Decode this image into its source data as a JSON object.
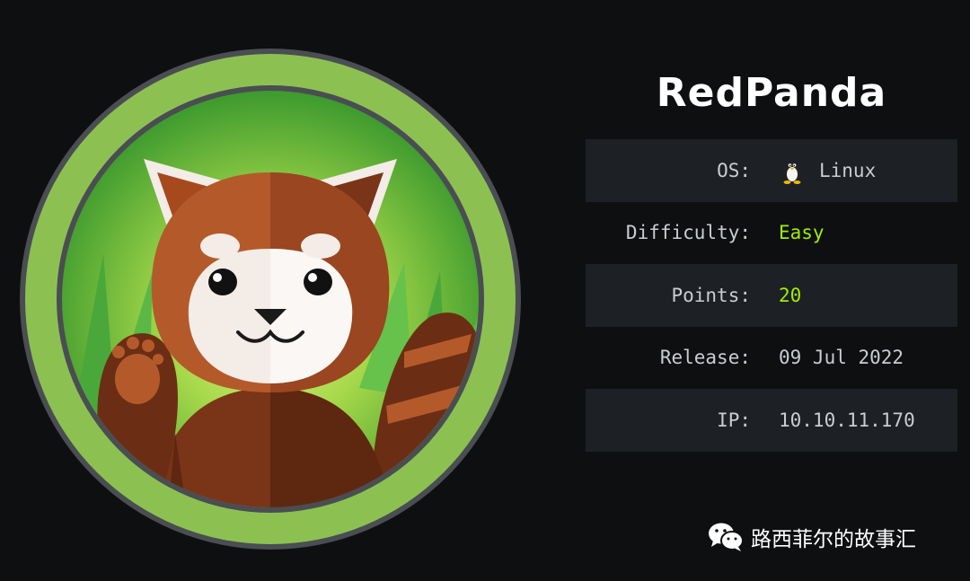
{
  "machine": {
    "name": "RedPanda",
    "logo_icon": "red-panda-avatar"
  },
  "info": {
    "os_label": "OS:",
    "os_value": "Linux",
    "os_icon": "linux-tux-icon",
    "difficulty_label": "Difficulty:",
    "difficulty_value": "Easy",
    "points_label": "Points:",
    "points_value": "20",
    "release_label": "Release:",
    "release_value": "09 Jul 2022",
    "ip_label": "IP:",
    "ip_value": "10.10.11.170"
  },
  "watermark": {
    "text": "路西菲尔的故事汇",
    "icon": "wechat-icon"
  },
  "colors": {
    "background": "#0e0f11",
    "row_shade": "#1d2024",
    "accent_green": "#9fef00",
    "ring_green": "#8cc152"
  }
}
